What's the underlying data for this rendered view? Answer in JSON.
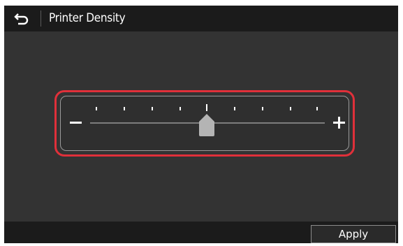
{
  "header": {
    "back_icon": "back-arrow-icon",
    "title": "Printer Density"
  },
  "slider": {
    "minus_icon": "minus-icon",
    "plus_icon": "plus-icon",
    "tick_count": 9,
    "selected_level": 5,
    "highlight_color": "#e0303a"
  },
  "footer": {
    "apply_label": "Apply"
  }
}
